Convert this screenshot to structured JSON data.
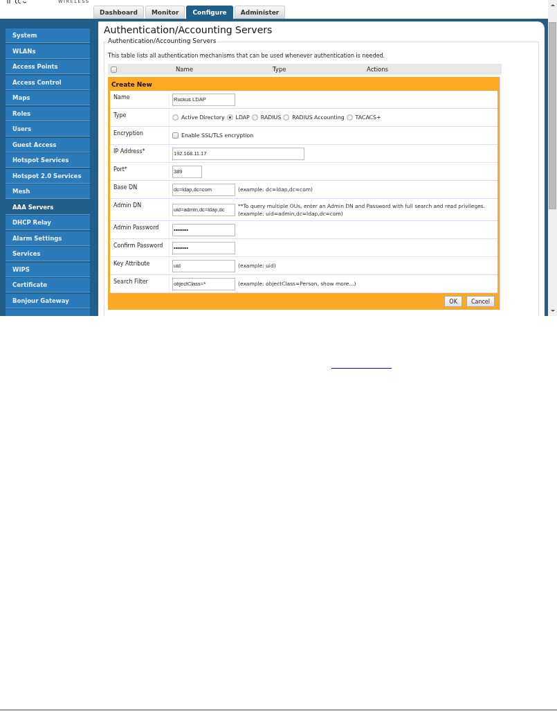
{
  "logo": {
    "text": "WIRELESS"
  },
  "tabs": [
    {
      "label": "Dashboard",
      "selected": false
    },
    {
      "label": "Monitor",
      "selected": false
    },
    {
      "label": "Configure",
      "selected": true
    },
    {
      "label": "Administer",
      "selected": false
    }
  ],
  "sidebar": {
    "items": [
      {
        "label": "System",
        "selected": false
      },
      {
        "label": "WLANs",
        "selected": false
      },
      {
        "label": "Access Points",
        "selected": false
      },
      {
        "label": "Access Control",
        "selected": false
      },
      {
        "label": "Maps",
        "selected": false
      },
      {
        "label": "Roles",
        "selected": false
      },
      {
        "label": "Users",
        "selected": false
      },
      {
        "label": "Guest Access",
        "selected": false
      },
      {
        "label": "Hotspot Services",
        "selected": false
      },
      {
        "label": "Hotspot 2.0 Services",
        "selected": false
      },
      {
        "label": "Mesh",
        "selected": false
      },
      {
        "label": "AAA Servers",
        "selected": true
      },
      {
        "label": "DHCP Relay",
        "selected": false
      },
      {
        "label": "Alarm Settings",
        "selected": false
      },
      {
        "label": "Services",
        "selected": false
      },
      {
        "label": "WIPS",
        "selected": false
      },
      {
        "label": "Certificate",
        "selected": false
      },
      {
        "label": "Bonjour Gateway",
        "selected": false
      }
    ]
  },
  "page_title": "Authentication/Accounting Servers",
  "section": {
    "legend": "Authentication/Accounting Servers",
    "description": "This table lists all authentication mechanisms that can be used whenever authentication is needed."
  },
  "table": {
    "select_all": {
      "checked": false
    },
    "columns": [
      "Name",
      "Type",
      "Actions"
    ]
  },
  "form": {
    "title": "Create New",
    "fields": [
      {
        "label": "Name",
        "kind": "text",
        "value": "Ruckus LDAP"
      },
      {
        "label": "Type",
        "kind": "radio",
        "options": [
          {
            "label": "Active Directory",
            "selected": false
          },
          {
            "label": "LDAP",
            "selected": true
          },
          {
            "label": "RADIUS",
            "selected": false
          },
          {
            "label": "RADIUS Accounting",
            "selected": false
          },
          {
            "label": "TACACS+",
            "selected": false
          }
        ]
      },
      {
        "label": "Encryption",
        "kind": "checkbox",
        "option": "Enable SSL/TLS encryption",
        "checked": false
      },
      {
        "label": "IP Address*",
        "kind": "wide-text",
        "value": "192.168.11.17"
      },
      {
        "label": "Port*",
        "kind": "short-text",
        "value": "389"
      },
      {
        "label": "Base DN",
        "kind": "text",
        "value": "dc=ldap,dc=com",
        "hint": [
          "(example: dc=ldap,dc=com)"
        ]
      },
      {
        "label": "Admin DN",
        "kind": "text",
        "value": "uid=admin,dc=ldap,dc",
        "hint": [
          "**To query multiple OUs, enter an Admin DN and Password with full search and read privileges.",
          "(example: uid=admin,dc=ldap,dc=com)"
        ]
      },
      {
        "label": "Admin Password",
        "kind": "password",
        "value": "••••••••"
      },
      {
        "label": "Confirm Password",
        "kind": "password",
        "value": "••••••••"
      },
      {
        "label": "Key Attribute",
        "kind": "text",
        "value": "uid",
        "hint": [
          "(example: uid)"
        ]
      },
      {
        "label": "Search Filter",
        "kind": "text",
        "value": "objectClass=*",
        "hint": [
          "(example: objectClass=Person, show more...)"
        ]
      }
    ],
    "buttons": [
      "OK",
      "Cancel"
    ]
  }
}
